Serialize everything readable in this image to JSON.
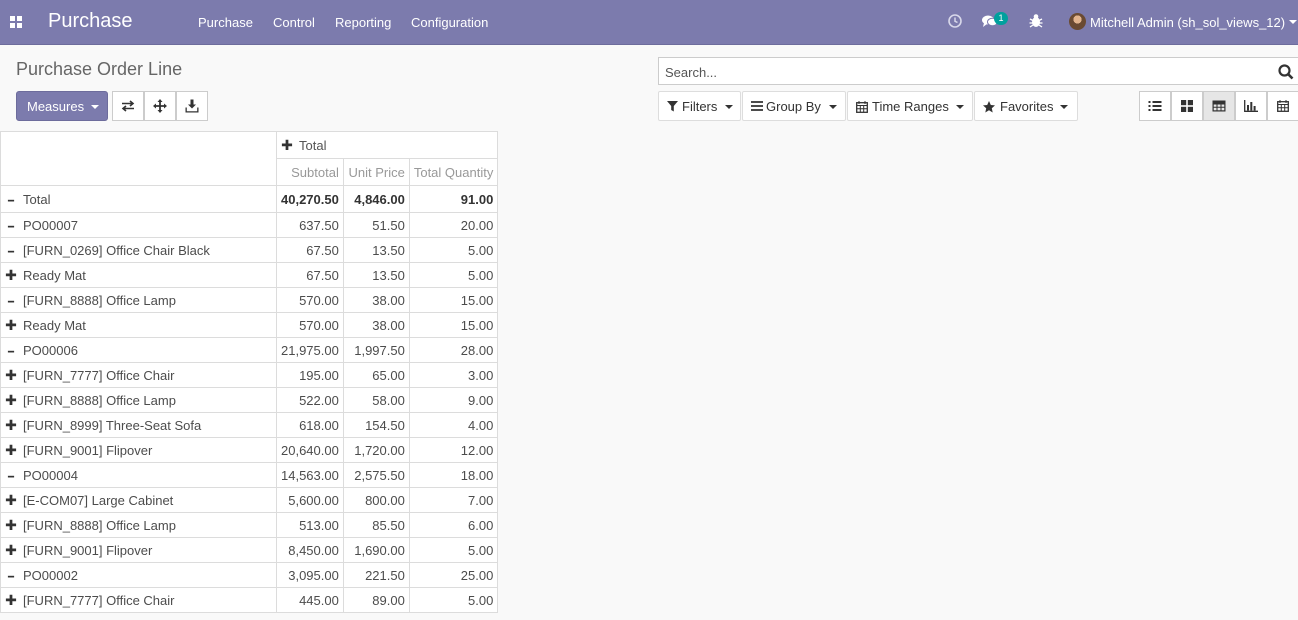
{
  "navbar": {
    "brand": "Purchase",
    "menu": [
      "Purchase",
      "Control",
      "Reporting",
      "Configuration"
    ],
    "messages_badge": "1",
    "user": "Mitchell Admin (sh_sol_views_12)",
    "accent": "#7c7bad"
  },
  "control_panel": {
    "title": "Purchase Order Line",
    "measures_label": "Measures",
    "search_placeholder": "Search...",
    "filters_label": "Filters",
    "groupby_label": "Group By",
    "timeranges_label": "Time Ranges",
    "favorites_label": "Favorites"
  },
  "pivot": {
    "col_group": "Total",
    "measures": [
      "Subtotal",
      "Unit Price",
      "Total Quantity"
    ],
    "rows": [
      {
        "level": 0,
        "sign": "minus",
        "label": "Total",
        "values": [
          "40,270.50",
          "4,846.00",
          "91.00"
        ]
      },
      {
        "level": 1,
        "sign": "minus",
        "label": "PO00007",
        "values": [
          "637.50",
          "51.50",
          "20.00"
        ]
      },
      {
        "level": 2,
        "sign": "minus",
        "label": "[FURN_0269] Office Chair Black",
        "values": [
          "67.50",
          "13.50",
          "5.00"
        ]
      },
      {
        "level": 3,
        "sign": "plus",
        "label": "Ready Mat",
        "values": [
          "67.50",
          "13.50",
          "5.00"
        ]
      },
      {
        "level": 2,
        "sign": "minus",
        "label": "[FURN_8888] Office Lamp",
        "values": [
          "570.00",
          "38.00",
          "15.00"
        ]
      },
      {
        "level": 3,
        "sign": "plus",
        "label": "Ready Mat",
        "values": [
          "570.00",
          "38.00",
          "15.00"
        ]
      },
      {
        "level": 1,
        "sign": "minus",
        "label": "PO00006",
        "values": [
          "21,975.00",
          "1,997.50",
          "28.00"
        ]
      },
      {
        "level": 2,
        "sign": "plus",
        "label": "[FURN_7777] Office Chair",
        "values": [
          "195.00",
          "65.00",
          "3.00"
        ]
      },
      {
        "level": 2,
        "sign": "plus",
        "label": "[FURN_8888] Office Lamp",
        "values": [
          "522.00",
          "58.00",
          "9.00"
        ]
      },
      {
        "level": 2,
        "sign": "plus",
        "label": "[FURN_8999] Three-Seat Sofa",
        "values": [
          "618.00",
          "154.50",
          "4.00"
        ]
      },
      {
        "level": 2,
        "sign": "plus",
        "label": "[FURN_9001] Flipover",
        "values": [
          "20,640.00",
          "1,720.00",
          "12.00"
        ]
      },
      {
        "level": 1,
        "sign": "minus",
        "label": "PO00004",
        "values": [
          "14,563.00",
          "2,575.50",
          "18.00"
        ]
      },
      {
        "level": 2,
        "sign": "plus",
        "label": "[E-COM07] Large Cabinet",
        "values": [
          "5,600.00",
          "800.00",
          "7.00"
        ]
      },
      {
        "level": 2,
        "sign": "plus",
        "label": "[FURN_8888] Office Lamp",
        "values": [
          "513.00",
          "85.50",
          "6.00"
        ]
      },
      {
        "level": 2,
        "sign": "plus",
        "label": "[FURN_9001] Flipover",
        "values": [
          "8,450.00",
          "1,690.00",
          "5.00"
        ]
      },
      {
        "level": 1,
        "sign": "minus",
        "label": "PO00002",
        "values": [
          "3,095.00",
          "221.50",
          "25.00"
        ]
      },
      {
        "level": 2,
        "sign": "plus",
        "label": "[FURN_7777] Office Chair",
        "values": [
          "445.00",
          "89.00",
          "5.00"
        ]
      }
    ]
  }
}
